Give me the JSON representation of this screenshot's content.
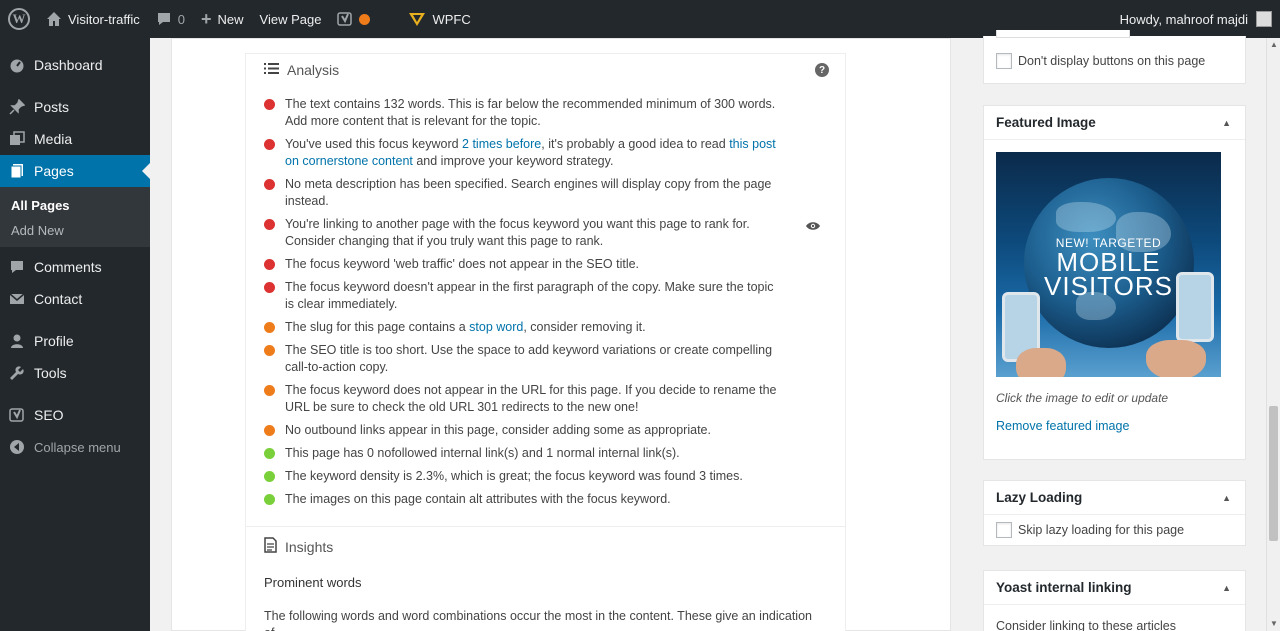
{
  "adminbar": {
    "site_name": "Visitor-traffic",
    "comments_count": "0",
    "new_label": "New",
    "view_page_label": "View Page",
    "wpfc_label": "WPFC",
    "howdy": "Howdy, mahroof majdi"
  },
  "menu": {
    "dashboard": "Dashboard",
    "posts": "Posts",
    "media": "Media",
    "pages": "Pages",
    "all_pages": "All Pages",
    "add_new": "Add New",
    "comments": "Comments",
    "contact": "Contact",
    "profile": "Profile",
    "tools": "Tools",
    "seo": "SEO",
    "collapse": "Collapse menu"
  },
  "analysis": {
    "title": "Analysis",
    "help": "?",
    "results": [
      {
        "status": "bad",
        "text": "The text contains 132 words. This is far below the recommended minimum of 300 words. Add more content that is relevant for the topic."
      },
      {
        "status": "bad",
        "pre": "You've used this focus keyword ",
        "link1": "2 times before",
        "mid": ", it's probably a good idea to read ",
        "link2": "this post on cornerstone content",
        "post": " and improve your keyword strategy."
      },
      {
        "status": "bad",
        "text": "No meta description has been specified. Search engines will display copy from the page instead."
      },
      {
        "status": "bad",
        "text": "You're linking to another page with the focus keyword you want this page to rank for. Consider changing that if you truly want this page to rank."
      },
      {
        "status": "bad",
        "text": "The focus keyword 'web traffic' does not appear in the SEO title."
      },
      {
        "status": "bad",
        "text": "The focus keyword doesn't appear in the first paragraph of the copy. Make sure the topic is clear immediately."
      },
      {
        "status": "ok",
        "pre": "The slug for this page contains a ",
        "link1": "stop word",
        "post": ", consider removing it."
      },
      {
        "status": "ok",
        "text": "The SEO title is too short. Use the space to add keyword variations or create compelling call-to-action copy."
      },
      {
        "status": "ok",
        "text": "The focus keyword does not appear in the URL for this page. If you decide to rename the URL be sure to check the old URL 301 redirects to the new one!"
      },
      {
        "status": "ok",
        "text": "No outbound links appear in this page, consider adding some as appropriate."
      },
      {
        "status": "good",
        "text": "This page has 0 nofollowed internal link(s) and 1 normal internal link(s)."
      },
      {
        "status": "good",
        "text": "The keyword density is 2.3%, which is great; the focus keyword was found 3 times."
      },
      {
        "status": "good",
        "text": "The images on this page contain alt attributes with the focus keyword."
      }
    ]
  },
  "insights": {
    "title": "Insights",
    "prominent_title": "Prominent words",
    "prominent_desc": "The following words and word combinations occur the most in the content. These give an indication of"
  },
  "sidebar": {
    "dont_display": "Don't display buttons on this page",
    "featured_title": "Featured Image",
    "featured_img_line1": "NEW! TARGETED",
    "featured_img_line2": "MOBILE",
    "featured_img_line3": "VISITORS",
    "featured_caption": "Click the image to edit or update",
    "remove_featured": "Remove featured image",
    "lazy_title": "Lazy Loading",
    "lazy_skip": "Skip lazy loading for this page",
    "yoast_title": "Yoast internal linking",
    "yoast_sub": "Consider linking to these articles"
  },
  "colors": {
    "bad": "#dc3232",
    "ok": "#ee7c1b",
    "good": "#7ad03a",
    "menu_active": "#0073aa",
    "link": "#0073aa"
  }
}
